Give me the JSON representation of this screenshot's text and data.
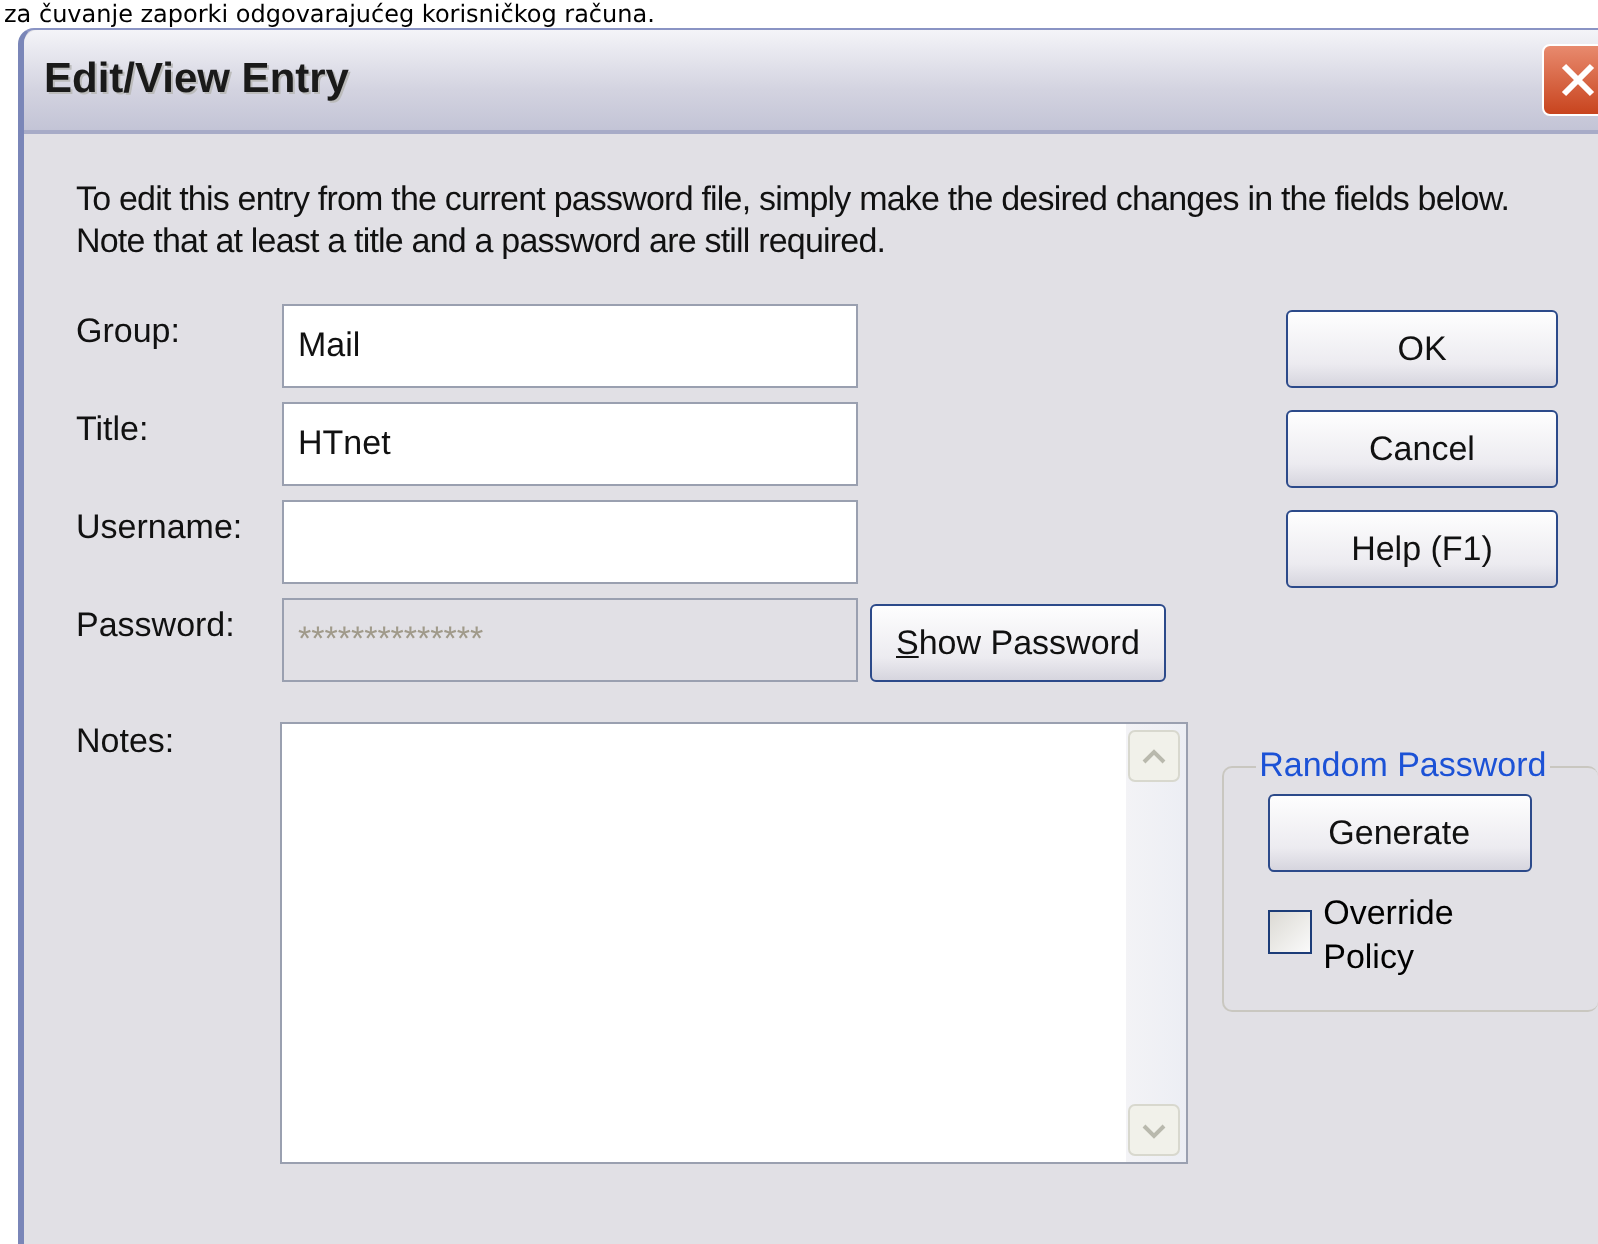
{
  "caption": "za čuvanje zaporki odgovarajućeg korisničkog računa.",
  "window": {
    "title": "Edit/View Entry"
  },
  "intro": "To edit this entry from the current password file, simply make the desired changes in the fields below.  Note that at least a title and a password are still required.",
  "fields": [
    {
      "label": "Group:",
      "value": "Mail",
      "disabled": false
    },
    {
      "label": "Title:",
      "value": "HTnet",
      "disabled": false
    },
    {
      "label": "Username:",
      "disabled": false
    },
    {
      "label": "Password:",
      "value": "**************",
      "disabled": true
    }
  ],
  "show_password_button": {
    "mnemonic": "S",
    "label": "how Password"
  },
  "buttons": [
    "OK",
    "Cancel",
    "Help (F1)"
  ],
  "notes": {
    "label": "Notes:"
  },
  "random_password": {
    "title": "Random Password",
    "button": "Generate",
    "override_policy": {
      "label": "Override Policy",
      "checked": false
    }
  }
}
